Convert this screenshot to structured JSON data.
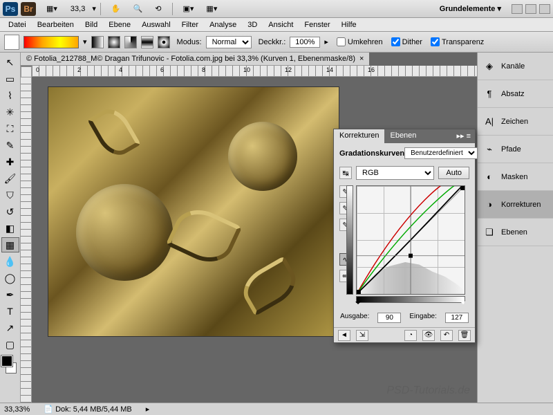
{
  "titlebar": {
    "zoom": "33,3",
    "workspace": "Grundelemente ▾"
  },
  "menu": [
    "Datei",
    "Bearbeiten",
    "Bild",
    "Ebene",
    "Auswahl",
    "Filter",
    "Analyse",
    "3D",
    "Ansicht",
    "Fenster",
    "Hilfe"
  ],
  "options": {
    "mode_label": "Modus:",
    "mode_value": "Normal",
    "opacity_label": "Deckkr.:",
    "opacity_value": "100%",
    "reverse": "Umkehren",
    "dither": "Dither",
    "transparency": "Transparenz"
  },
  "document": {
    "tab": "© Fotolia_212788_M© Dragan Trifunovic - Fotolia.com.jpg bei 33,3% (Kurven 1, Ebenenmaske/8)",
    "ruler_marks": [
      "0",
      "2",
      "4",
      "6",
      "8",
      "10",
      "12",
      "14",
      "16"
    ]
  },
  "right_panels": [
    "Kanäle",
    "Absatz",
    "Zeichen",
    "Pfade",
    "Masken",
    "Korrekturen",
    "Ebenen"
  ],
  "curves": {
    "tab1": "Korrekturen",
    "tab2": "Ebenen",
    "title": "Gradationskurven",
    "preset": "Benutzerdefiniert",
    "channel": "RGB",
    "auto": "Auto",
    "output_label": "Ausgabe:",
    "output_value": "90",
    "input_label": "Eingabe:",
    "input_value": "127"
  },
  "status": {
    "zoom": "33,33%",
    "doc": "Dok: 5,44 MB/5,44 MB"
  },
  "watermark": "PSD-Tutorials.de"
}
